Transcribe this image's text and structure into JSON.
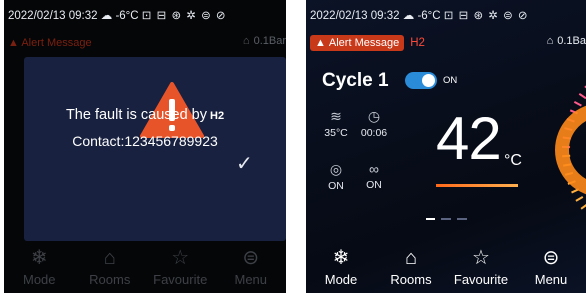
{
  "left": {
    "status": {
      "datetime": "2022/02/13 09:32",
      "weather": "-6°C",
      "icons": "⊡ ⊟ ⊛ ✲ ⊜ ⊘"
    },
    "alert": {
      "label": "Alert Message",
      "pressure": "0.1Bar"
    },
    "dialog": {
      "message": "The fault is caused by",
      "code": "H2",
      "contact": "Contact:123456789923",
      "confirm_icon": "check-icon"
    },
    "nav": [
      {
        "label": "Mode",
        "icon": "snowflake-sun-icon"
      },
      {
        "label": "Rooms",
        "icon": "house-icon"
      },
      {
        "label": "Favourite",
        "icon": "star-icon"
      },
      {
        "label": "Menu",
        "icon": "menu-icon"
      }
    ]
  },
  "right": {
    "status": {
      "datetime": "2022/02/13 09:32",
      "weather": "-6°C",
      "icons": "⊡ ⊟ ⊛ ✲ ⊜ ⊘"
    },
    "alert": {
      "label": "Alert Message",
      "code": "H2",
      "pressure": "0.1Ba"
    },
    "cycle": {
      "title": "Cycle 1",
      "toggle_label": "ON",
      "toggle_on": true
    },
    "stats": [
      {
        "icon": "water-temp-icon",
        "value": "35°C"
      },
      {
        "icon": "timer-icon",
        "value": "00:06"
      },
      {
        "icon": "eco-icon",
        "value": "ON"
      },
      {
        "icon": "cycle-icon",
        "value": "ON"
      }
    ],
    "temperature": {
      "value": "42",
      "unit": "°C"
    },
    "nav": [
      {
        "label": "Mode",
        "icon": "snowflake-sun-icon"
      },
      {
        "label": "Rooms",
        "icon": "house-icon"
      },
      {
        "label": "Favourite",
        "icon": "star-icon"
      },
      {
        "label": "Menu",
        "icon": "menu-icon"
      }
    ],
    "colors": {
      "accent": "#c8391a",
      "toggle": "#2a8bd9",
      "dial": "#ff7a1a"
    }
  }
}
